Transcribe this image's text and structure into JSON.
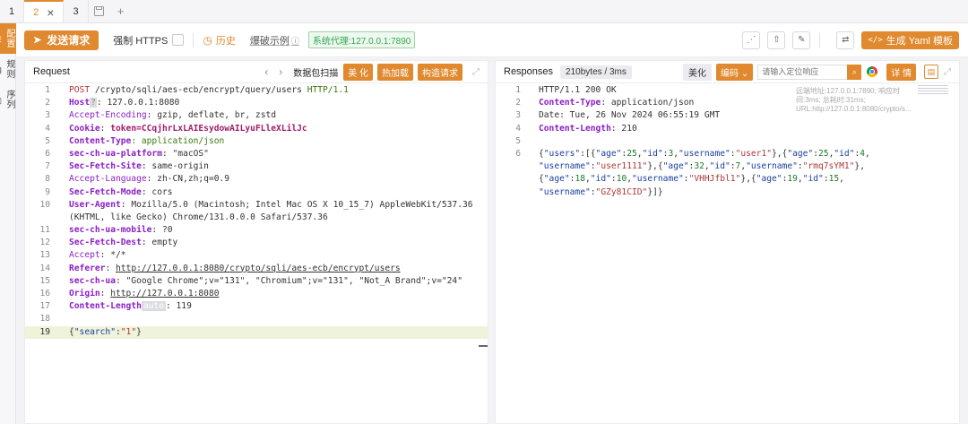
{
  "tabs": [
    "1",
    "2",
    "3"
  ],
  "sidebar": [
    "配置",
    "规则",
    "序列"
  ],
  "toolbar": {
    "send": "发送请求",
    "force_https": "强制 HTTPS",
    "history": "历史",
    "example": "爆破示例",
    "proxy": "系统代理:127.0.0.1:7890",
    "yaml": "生成 Yaml 模板"
  },
  "request": {
    "title": "Request",
    "scan_label": "数据包扫描",
    "beautify": "美 化",
    "hot_load": "热加载",
    "build": "构造请求",
    "lines": [
      {
        "no": "1"
      },
      {
        "no": "2"
      },
      {
        "no": "3"
      },
      {
        "no": "4"
      },
      {
        "no": "5"
      },
      {
        "no": "6"
      },
      {
        "no": "7"
      },
      {
        "no": "8"
      },
      {
        "no": "9"
      },
      {
        "no": "10"
      },
      {
        "no": ""
      },
      {
        "no": "11"
      },
      {
        "no": "12"
      },
      {
        "no": "13"
      },
      {
        "no": "14"
      },
      {
        "no": "15"
      },
      {
        "no": "16"
      },
      {
        "no": "17"
      },
      {
        "no": "18"
      },
      {
        "no": "19"
      }
    ],
    "text": {
      "l1a": "POST",
      "l1b": " /crypto/sqli/aes-ecb/encrypt/query/users ",
      "l1c": "HTTP/1.1",
      "l2k": "Host",
      "l2q": "?",
      "l2v": ": 127.0.0.1:8080",
      "l3k": "Accept-Encoding",
      "l3v": ": gzip, deflate, br, zstd",
      "l4k": "Cookie",
      "l4c": ": ",
      "l4t": "token=CCqjhrLxLAIEsydowAILyuFLleXLilJc",
      "l5k": "Content-Type",
      "l5v": ": application/json",
      "l6k": "sec-ch-ua-platform",
      "l6v": ": \"macOS\"",
      "l7k": "Sec-Fetch-Site",
      "l7v": ": same-origin",
      "l8k": "Accept-Language",
      "l8v": ": zh-CN,zh;q=0.9",
      "l9k": "Sec-Fetch-Mode",
      "l9v": ": cors",
      "l10k": "User-Agent",
      "l10v": ": Mozilla/5.0 (Macintosh; Intel Mac OS X 10_15_7) AppleWebKit/537.36",
      "l10w": "(KHTML, like Gecko) Chrome/131.0.0.0 Safari/537.36",
      "l11k": "sec-ch-ua-mobile",
      "l11v": ": ?0",
      "l12k": "Sec-Fetch-Dest",
      "l12v": ": empty",
      "l13k": "Accept",
      "l13v": ": */*",
      "l14k": "Referer",
      "l14c": ": ",
      "l14v": "http://127.0.0.1:8080/crypto/sqli/aes-ecb/encrypt/users",
      "l15k": "sec-ch-ua",
      "l15v": ": \"Google Chrome\";v=\"131\", \"Chromium\";v=\"131\", \"Not_A Brand\";v=\"24\"",
      "l16k": "Origin",
      "l16c": ": ",
      "l16v": "http://127.0.0.1:8080",
      "l17k": "Content-Length",
      "l17a": "auto",
      "l17v": ": 119",
      "l19a": "{",
      "l19k": "\"search\"",
      "l19c": ":",
      "l19s": "\"1\"",
      "l19z": "}"
    }
  },
  "response": {
    "title": "Responses",
    "stats": "210bytes / 3ms",
    "beautify": "美化",
    "encoding": "编码",
    "search_placeholder": "请输入定位响应",
    "detail": "详 情",
    "meta": "远端地址:127.0.0.1:7890; 响应时间:3ms; 总耗时:31ms; URL:http://127.0.0.1:8080/crypto/s...",
    "line_nos": [
      "1",
      "2",
      "3",
      "4",
      "5",
      "6"
    ],
    "text": {
      "r1": "HTTP/1.1 200 OK",
      "r2k": "Content-Type",
      "r2v": ": application/json",
      "r3": "Date: Tue, 26 Nov 2024 06:55:19 GMT",
      "r4k": "Content-Length",
      "r4v": ": 210"
    },
    "json_users": [
      {
        "age": "25",
        "id": "3",
        "username": "user1"
      },
      {
        "age": "25",
        "id": "4",
        "username": "user1111"
      },
      {
        "age": "32",
        "id": "7",
        "username": "rmq7sYM1"
      },
      {
        "age": "18",
        "id": "10",
        "username": "VHHJfbl1"
      },
      {
        "age": "19",
        "id": "15",
        "username": "GZy81CID"
      }
    ]
  },
  "colors": {
    "accent": "#e0892e",
    "proxy_green": "#34a853",
    "header_purple": "#8a1ec7"
  },
  "icons": [
    "close-icon",
    "save-icon",
    "plus-icon",
    "paper-plane-icon",
    "clock-icon",
    "share-icon",
    "upload-icon",
    "edit-icon",
    "swap-icon",
    "code-icon",
    "search-icon",
    "chrome-icon",
    "chat-icon",
    "expand-icon"
  ]
}
